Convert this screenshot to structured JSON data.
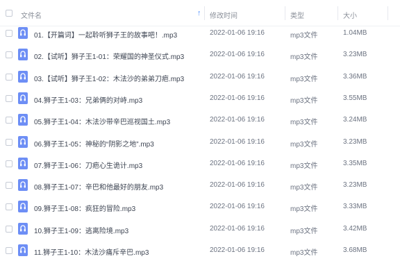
{
  "header": {
    "name": "文件名",
    "modified": "修改时间",
    "type": "类型",
    "size": "大小",
    "sort_icon": "arrow-up-icon"
  },
  "files": [
    {
      "name": "01.【开篇词】一起聆听狮子王的故事吧！.mp3",
      "modified": "2022-01-06 19:16",
      "type": "mp3文件",
      "size": "1.04MB"
    },
    {
      "name": "02.【试听】狮子王1-01：荣耀国的神圣仪式.mp3",
      "modified": "2022-01-06 19:16",
      "type": "mp3文件",
      "size": "3.23MB"
    },
    {
      "name": "03.【试听】狮子王1-02：木法沙的弟弟刀疤.mp3",
      "modified": "2022-01-06 19:16",
      "type": "mp3文件",
      "size": "3.36MB"
    },
    {
      "name": "04.狮子王1-03：兄弟俩的对峙.mp3",
      "modified": "2022-01-06 19:16",
      "type": "mp3文件",
      "size": "3.55MB"
    },
    {
      "name": "05.狮子王1-04：木法沙带辛巴巡视国土.mp3",
      "modified": "2022-01-06 19:16",
      "type": "mp3文件",
      "size": "3.24MB"
    },
    {
      "name": "06.狮子王1-05：神秘的“阴影之地”.mp3",
      "modified": "2022-01-06 19:16",
      "type": "mp3文件",
      "size": "3.23MB"
    },
    {
      "name": "07.狮子王1-06：刀疤心生诡计.mp3",
      "modified": "2022-01-06 19:16",
      "type": "mp3文件",
      "size": "3.35MB"
    },
    {
      "name": "08.狮子王1-07：辛巴和他最好的朋友.mp3",
      "modified": "2022-01-06 19:16",
      "type": "mp3文件",
      "size": "3.23MB"
    },
    {
      "name": "09.狮子王1-08：疯狂的冒险.mp3",
      "modified": "2022-01-06 19:16",
      "type": "mp3文件",
      "size": "3.33MB"
    },
    {
      "name": "10.狮子王1-09：逃离险境.mp3",
      "modified": "2022-01-06 19:16",
      "type": "mp3文件",
      "size": "3.42MB"
    },
    {
      "name": "11.狮子王1-10：木法沙痛斥辛巴.mp3",
      "modified": "2022-01-06 19:16",
      "type": "mp3文件",
      "size": "3.68MB"
    }
  ],
  "file_icon": "audio-file-icon"
}
